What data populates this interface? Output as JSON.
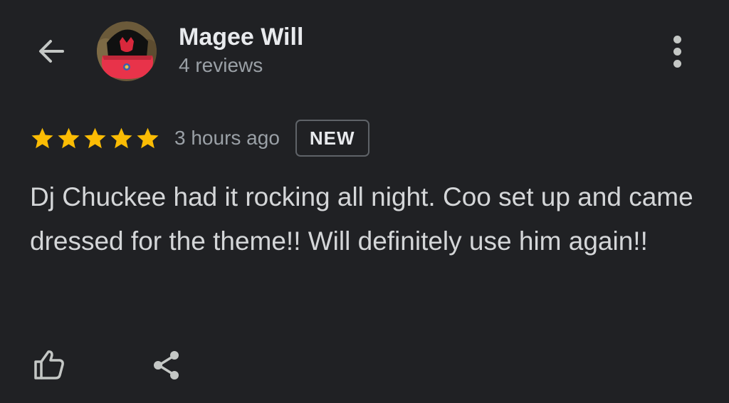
{
  "header": {
    "back_icon": "arrow-left-icon",
    "reviewer_name": "Magee Will",
    "review_count": "4 reviews",
    "more_icon": "more-vertical-icon"
  },
  "review": {
    "rating": 5,
    "rating_max": 5,
    "star_color": "#fbbc04",
    "time_ago": "3 hours ago",
    "badge": "NEW",
    "text": "Dj Chuckee had it rocking all night. Coo set up and came dressed for the theme!! Will definitely use him again!!"
  },
  "actions": {
    "like_icon": "thumbs-up-icon",
    "share_icon": "share-icon"
  },
  "colors": {
    "background": "#202124",
    "primary_text": "#e8eaed",
    "secondary_text": "#9aa0a6"
  }
}
